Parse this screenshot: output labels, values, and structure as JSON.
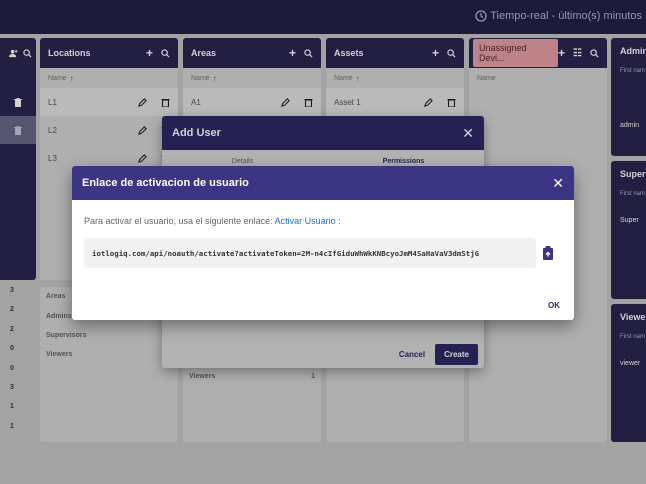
{
  "topbar": {
    "time_label": "Tiempo-real - último(s) minutos"
  },
  "columns": {
    "locations": {
      "title": "Locations",
      "sort_label": "Name",
      "rows": [
        "L1",
        "L2",
        "L3"
      ]
    },
    "areas": {
      "title": "Areas",
      "sort_label": "Name",
      "rows": [
        "A1"
      ]
    },
    "assets": {
      "title": "Assets",
      "sort_label": "Name",
      "rows": [
        "Asset 1"
      ]
    },
    "unassigned": {
      "title": "Unassigned Devi...",
      "sort_label": "Name"
    },
    "admins": {
      "title": "Admin",
      "sub_label": "First nam",
      "rows": [
        "admin"
      ]
    },
    "supervisors": {
      "title": "Superv",
      "sub_label": "First nam",
      "rows": [
        "Super"
      ]
    },
    "viewers": {
      "title": "Viewer",
      "sub_label": "First nam",
      "rows": [
        "viewer"
      ]
    }
  },
  "left_stats": [
    "3",
    "2",
    "2",
    "0",
    "0",
    "3",
    "1",
    "1"
  ],
  "loc_stats": [
    {
      "label": "Areas",
      "value": ""
    },
    {
      "label": "Admins",
      "value": ""
    },
    {
      "label": "Supervisors",
      "value": "1"
    },
    {
      "label": "Viewers",
      "value": "1"
    }
  ],
  "area_stats": [
    {
      "label": "Viewers",
      "value": "1"
    }
  ],
  "add_user_dialog": {
    "title": "Add User",
    "tab_details": "Details",
    "tab_permissions": "Permissions",
    "cancel_label": "Cancel",
    "create_label": "Create"
  },
  "activation_dialog": {
    "title": "Enlace de activacion de usuario",
    "instruction": "Para activar el usuario, usa el siguiente enlace:",
    "link_text": "Activar Usuario",
    "suffix": ":",
    "url": "iotlogiq.com/api/noauth/activate?activateToken=2M-n4cIfGiduWhWkKNBcyoJmM4SaHaVaV3dmStjG",
    "ok_label": "OK"
  }
}
